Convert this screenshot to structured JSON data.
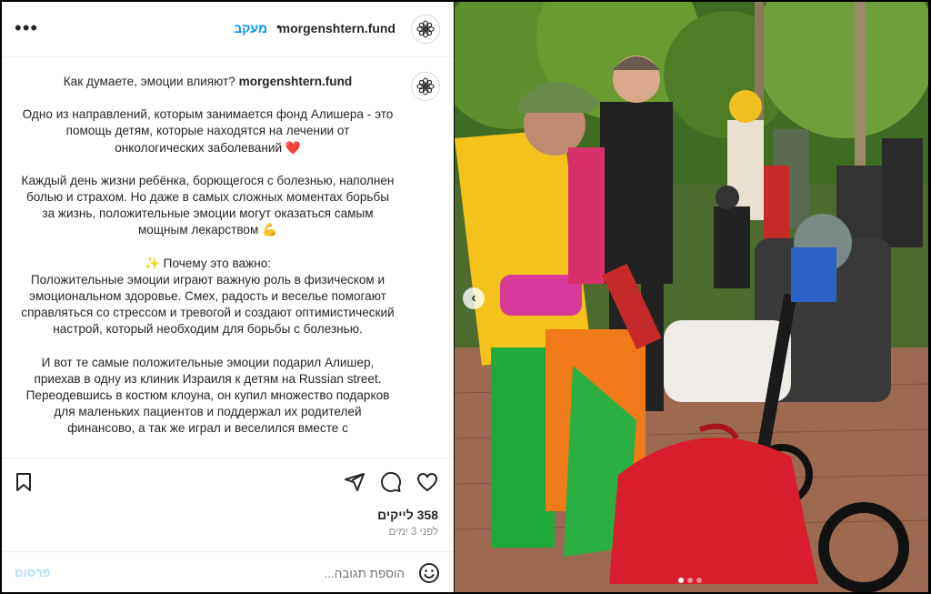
{
  "header": {
    "username": "morgenshtern.fund",
    "separator": "•",
    "follow_label": "מעקב",
    "more_label": "•••"
  },
  "caption": {
    "intro": "Как думаете, эмоции влияют?",
    "username": "morgenshtern.fund",
    "p1": "Одно из направлений, которым занимается фонд Алишера - это помощь детям, которые находятся на лечении от онкологических заболеваний",
    "p1_emoji": "❤️",
    "p2": "Каждый день жизни ребёнка, борющегося с болезнью, наполнен болью и страхом. Но даже в самых сложных моментах борьбы за жизнь, положительные эмоции могут оказаться самым мощным лекарством",
    "p2_emoji": "💪",
    "p3_title_emoji": "✨",
    "p3_title": "Почему это важно:",
    "p3": "Положительные эмоции играют важную роль в физическом и эмоциональном здоровье. Смех, радость и веселье помогают справляться со стрессом и тревогой и создают оптимистический настрой, который необходим для борьбы с болезнью.",
    "p4": "И вот те самые положительные эмоции подарил Алишер, приехав в одну из клиник Израиля к детям на Russian street. Переодевшись в костюм клоуна, он купил множество подарков для маленьких пациентов и поддержал их родителей финансово, а так же играл и веселился вместе с"
  },
  "actions": {
    "likes": "358 לייקים",
    "time": "לפני 3 ימים"
  },
  "comment": {
    "placeholder": "הוספת תגובה...",
    "post_label": "פרסום"
  },
  "icons": {
    "save": "bookmark-icon",
    "share": "send-icon",
    "comment": "comment-icon",
    "like": "heart-icon",
    "emoji": "smiley-icon",
    "avatar": "flower-logo-icon"
  },
  "carousel": {
    "prev_glyph": "‹",
    "slides": 3,
    "active_index": 0
  },
  "colors": {
    "accent": "#0095f6",
    "post_disabled": "#b2dffc",
    "muted": "#8e8e8e"
  }
}
